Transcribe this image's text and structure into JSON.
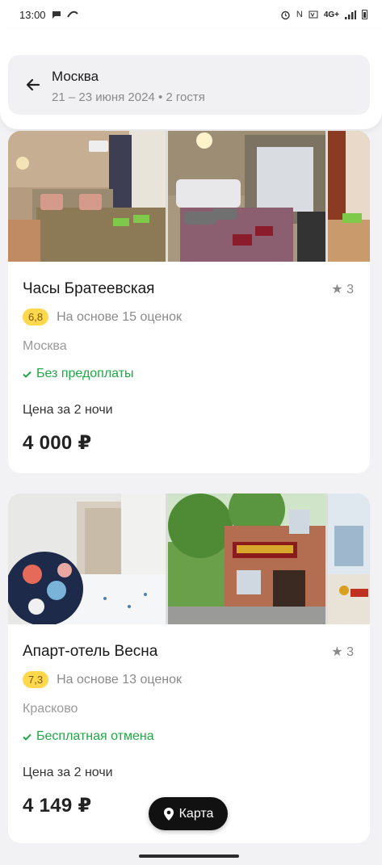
{
  "status_bar": {
    "time": "13:00",
    "network": "4G+"
  },
  "header": {
    "title": "Москва",
    "subtitle": "21 – 23 июня 2024 • 2 гостя"
  },
  "hotels": [
    {
      "name": "Часы Братеевская",
      "stars": "3",
      "rating": "6,8",
      "reviews": "На основе 15 оценок",
      "city": "Москва",
      "feature": "Без предоплаты",
      "price_label": "Цена за 2 ночи",
      "price": "4 000 ₽"
    },
    {
      "name": "Апарт-отель Весна",
      "stars": "3",
      "rating": "7,3",
      "reviews": "На основе 13 оценок",
      "city": "Красково",
      "feature": "Бесплатная отмена",
      "price_label": "Цена за 2 ночи",
      "price": "4 149 ₽"
    }
  ],
  "map_button": {
    "label": "Карта"
  },
  "colors": {
    "accent_green": "#1fa845",
    "rating_yellow": "#ffd84d",
    "map_button_bg": "#111111"
  }
}
